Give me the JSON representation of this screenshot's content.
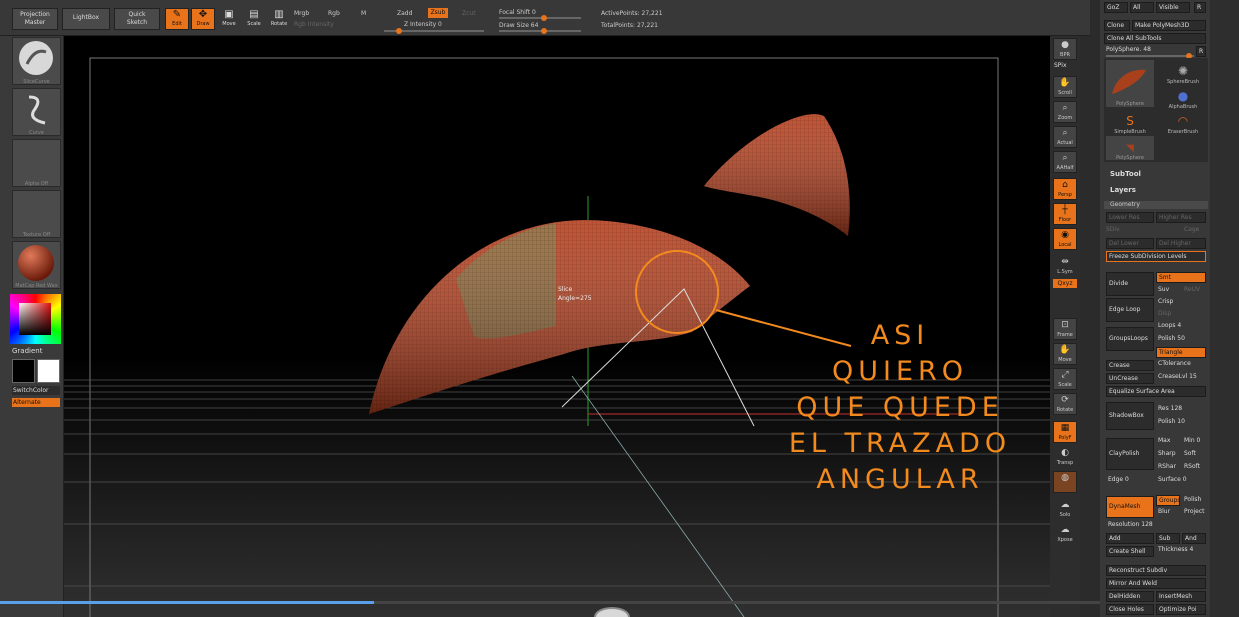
{
  "toolbar": {
    "projection_master": "Projection\nMaster",
    "lightbox": "LightBox",
    "quick_sketch": "Quick\nSketch",
    "tools": [
      {
        "name": "edit",
        "label": "Edit",
        "icon": "edit-icon",
        "active": true
      },
      {
        "name": "draw",
        "label": "Draw",
        "icon": "draw-icon",
        "active": true
      },
      {
        "name": "move",
        "label": "Move",
        "icon": "move-icon",
        "active": false
      },
      {
        "name": "scale",
        "label": "Scale",
        "icon": "scale-icon",
        "active": false
      },
      {
        "name": "rotate",
        "label": "Rotate",
        "icon": "rotate-icon",
        "active": false
      }
    ],
    "mrgb": "Mrgb",
    "rgb": "Rgb",
    "m": "M",
    "rgb_intensity": "Rgb Intensity",
    "zadd": "Zadd",
    "zsub": "Zsub",
    "zcut": "Zcut",
    "z_intensity": "Z Intensity 0",
    "focal_shift": "Focal Shift 0",
    "draw_size": "Draw Size 64",
    "active_points": "ActivePoints: 27,221",
    "total_points": "TotalPoints: 27,221"
  },
  "left_shelf": {
    "brush_label": "SliceCurve",
    "stroke_label": "Curve",
    "alpha_label": "Alpha Off",
    "texture_label": "Texture Off",
    "material_label": "MatCap Red Wax",
    "gradient": "Gradient",
    "switch_color": "SwitchColor",
    "alternate": "Alternate"
  },
  "right_strip": {
    "items": [
      {
        "name": "bpr",
        "label": "BPR",
        "icon": "sphere-icon",
        "active": false
      },
      {
        "name": "spix",
        "label": "SPix",
        "icon": "",
        "active": false
      },
      {
        "name": "scroll",
        "label": "Scroll",
        "icon": "hand-icon",
        "active": false
      },
      {
        "name": "zoom",
        "label": "Zoom",
        "icon": "magnifier-icon",
        "active": false
      },
      {
        "name": "actual",
        "label": "Actual",
        "icon": "magnifier-icon",
        "active": false
      },
      {
        "name": "aahalf",
        "label": "AAHalf",
        "icon": "magnifier-icon",
        "active": false
      },
      {
        "name": "persp",
        "label": "Persp",
        "icon": "perspective-icon",
        "active": true
      },
      {
        "name": "floor",
        "label": "Floor",
        "icon": "floor-icon",
        "active": true
      },
      {
        "name": "local",
        "label": "Local",
        "icon": "local-icon",
        "active": true
      },
      {
        "name": "lsym",
        "label": "L.Sym",
        "icon": "symmetry-icon",
        "active": false
      },
      {
        "name": "xyz",
        "label": "Qxyz",
        "icon": "",
        "active": true
      },
      {
        "name": "frame",
        "label": "Frame",
        "icon": "frame-icon",
        "active": false
      },
      {
        "name": "move",
        "label": "Move",
        "icon": "hand-icon",
        "active": false
      },
      {
        "name": "scale",
        "label": "Scale",
        "icon": "scale-icon",
        "active": false
      },
      {
        "name": "rotate",
        "label": "Rotate",
        "icon": "rotate-icon",
        "active": false
      },
      {
        "name": "polyf",
        "label": "PolyF",
        "icon": "polyframe-icon",
        "active": true
      },
      {
        "name": "transp",
        "label": "Transp",
        "icon": "transparency-icon",
        "active": false
      },
      {
        "name": "ghost",
        "label": "",
        "icon": "ghost-icon",
        "active": false
      },
      {
        "name": "solo",
        "label": "Solo",
        "icon": "solo-icon",
        "active": false
      },
      {
        "name": "xpose",
        "label": "Xpose",
        "icon": "xpose-icon",
        "active": false
      }
    ]
  },
  "right_panel": {
    "goz": "GoZ",
    "all": "All",
    "visible": "Visible",
    "r": "R",
    "clone": "Clone",
    "make_polymesh": "Make PolyMesh3D",
    "clone_all_subtools": "Clone All SubTools",
    "polysphere": "PolySphere. 48",
    "tool_thumbs": [
      "PolySphere",
      "SphereBrush",
      "AlphaBrush",
      "SimpleBrush",
      "EraserBrush",
      "PolySphere"
    ],
    "subtool": "SubTool",
    "layers": "Layers",
    "geometry": "Geometry",
    "lower_res": "Lower Res",
    "higher_res": "Higher Res",
    "sdiv": "SDiv",
    "cage": "Cage",
    "del_lower": "Del Lower",
    "del_higher": "Del Higher",
    "freeze_subdiv": "Freeze SubDivision Levels",
    "divide": "Divide",
    "smt": "Smt",
    "suv": "Suv",
    "reuv": "ReUV",
    "edge_loop": "Edge Loop",
    "crisp": "Crisp",
    "disp": "Disp",
    "loops": "Loops 4",
    "grouploops": "GroupsLoops",
    "polish": "Polish 50",
    "triangle": "Triangle",
    "crease": "Crease",
    "ctolerance": "CTolerance",
    "uncrease": "UnCrease",
    "creaselvl": "CreaseLvl 15",
    "equalize": "Equalize Surface Area",
    "shadowbox": "ShadowBox",
    "res": "Res 128",
    "polish10": "Polish 10",
    "claypolish": "ClayPolish",
    "max": "Max",
    "min": "Min 0",
    "sharp": "Sharp",
    "soft": "Soft",
    "rshar": "RShar",
    "rsoft": "RSoft",
    "edge": "Edge 0",
    "surface": "Surface 0",
    "dynamesh": "DynaMesh",
    "groups": "Groups",
    "polish2": "Polish",
    "blur": "Blur",
    "project": "Project",
    "resolution": "Resolution 128",
    "add": "Add",
    "sub": "Sub",
    "and": "And",
    "create_shell": "Create Shell",
    "thickness": "Thickness 4",
    "reconstruct": "Reconstruct Subdiv",
    "mirror_weld": "Mirror And Weld",
    "delhidden": "DelHidden",
    "insert_mesh": "InsertMesh",
    "close_holes": "Close Holes",
    "optimize": "Optimize Poi"
  },
  "viewport": {
    "gizmo_label_1": "Slice",
    "gizmo_label_2": "Angle=275",
    "annotation": [
      "ASI",
      "QUIERO",
      "QUE QUEDE",
      "EL TRAZADO",
      "ANGULAR"
    ],
    "annotation_color": "#f28a1e"
  },
  "colors": {
    "accent": "#e8731a",
    "model": "#b6401e",
    "progress": "#5aa0e8"
  },
  "video": {
    "progress_fraction": 0.34
  }
}
